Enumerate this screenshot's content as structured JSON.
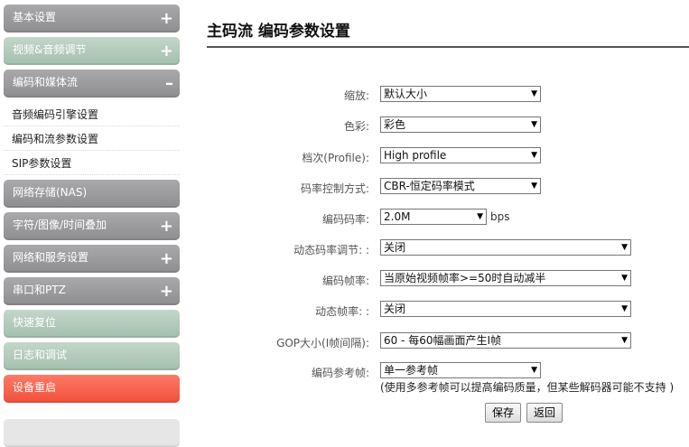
{
  "sidebar": {
    "menus": [
      {
        "label": "基本设置",
        "sign": "+"
      },
      {
        "label": "视频&音频调节",
        "sign": "+"
      },
      {
        "label": "编码和媒体流",
        "sign": "–"
      },
      {
        "label": "网络存储(NAS)",
        "sign": ""
      },
      {
        "label": "字符/图像/时间叠加",
        "sign": "+"
      },
      {
        "label": "网络和服务设置",
        "sign": "+"
      },
      {
        "label": "串口和PTZ",
        "sign": "+"
      },
      {
        "label": "快速复位",
        "sign": ""
      },
      {
        "label": "日志和调试",
        "sign": ""
      },
      {
        "label": "设备重启",
        "sign": ""
      }
    ],
    "sub_items": [
      {
        "label": "音频编码引擎设置"
      },
      {
        "label": "编码和流参数设置"
      },
      {
        "label": "SIP参数设置"
      }
    ]
  },
  "main": {
    "title": "主码流 编码参数设置",
    "fields": [
      {
        "label": "缩放:",
        "value": "默认大小"
      },
      {
        "label": "色彩:",
        "value": "彩色"
      },
      {
        "label": "档次(Profile):",
        "value": "High profile"
      },
      {
        "label": "码率控制方式:",
        "value": "CBR-恒定码率模式"
      },
      {
        "label": "编码码率:",
        "value": "2.0M",
        "unit": "bps"
      },
      {
        "label": "动态码率调节: :",
        "value": "关闭"
      },
      {
        "label": "编码帧率:",
        "value": "当原始视频帧率>=50时自动减半"
      },
      {
        "label": "动态帧率: :",
        "value": "关闭"
      },
      {
        "label": "GOP大小(I帧间隔):",
        "value": "60 - 每60幅画面产生I帧"
      },
      {
        "label": "编码参考帧:",
        "value": "单一参考帧",
        "hint": "(使用多参考帧可以提高编码质量，但某些解码器可能不支持 )"
      }
    ],
    "buttons": {
      "save": "保存",
      "back": "返回"
    }
  }
}
